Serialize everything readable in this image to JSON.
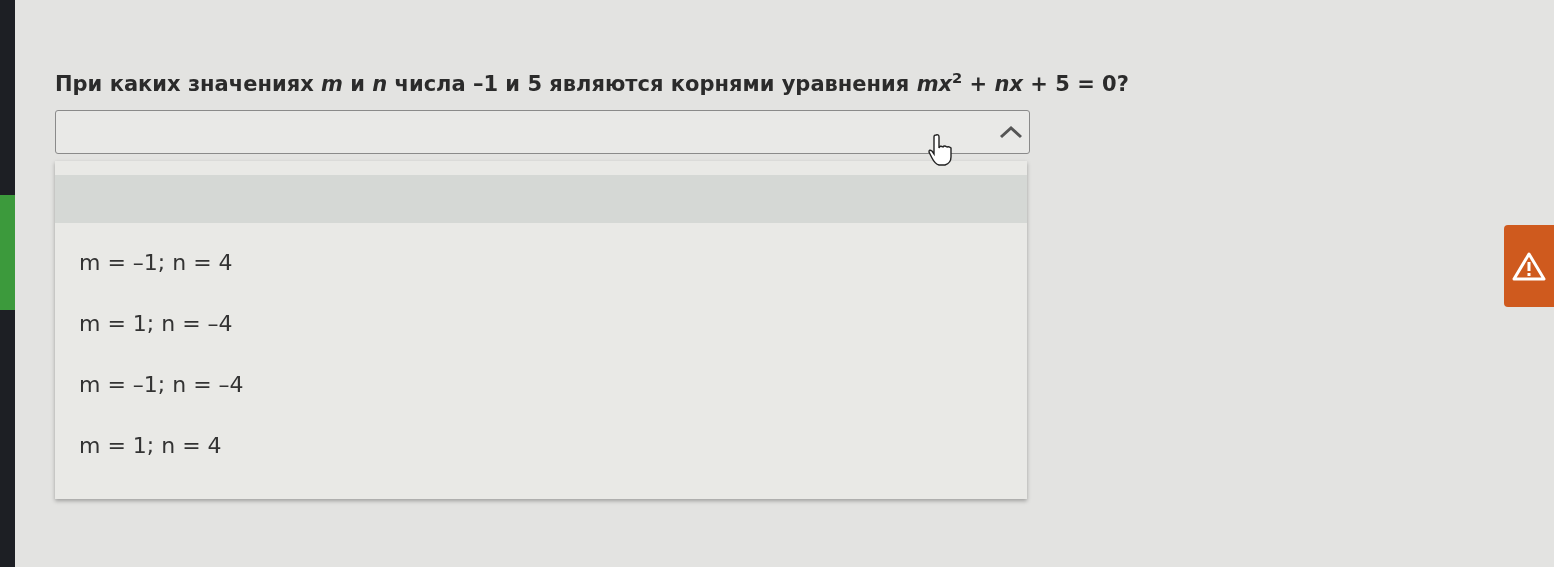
{
  "question": "При каких значениях *m* и *n* числа –1 и 5 являются корнями уравнения *mx*$^{2}$ + *nx* + 5 = 0?",
  "dropdown": {
    "expanded": true,
    "options": [
      {
        "label": "m = –1; n = 4",
        "selected": false
      },
      {
        "label": "m = 1; n = –4",
        "selected": false
      },
      {
        "label": "m = –1; n = –4",
        "selected": false
      },
      {
        "label": "m = 1; n = 4",
        "selected": false
      }
    ]
  }
}
